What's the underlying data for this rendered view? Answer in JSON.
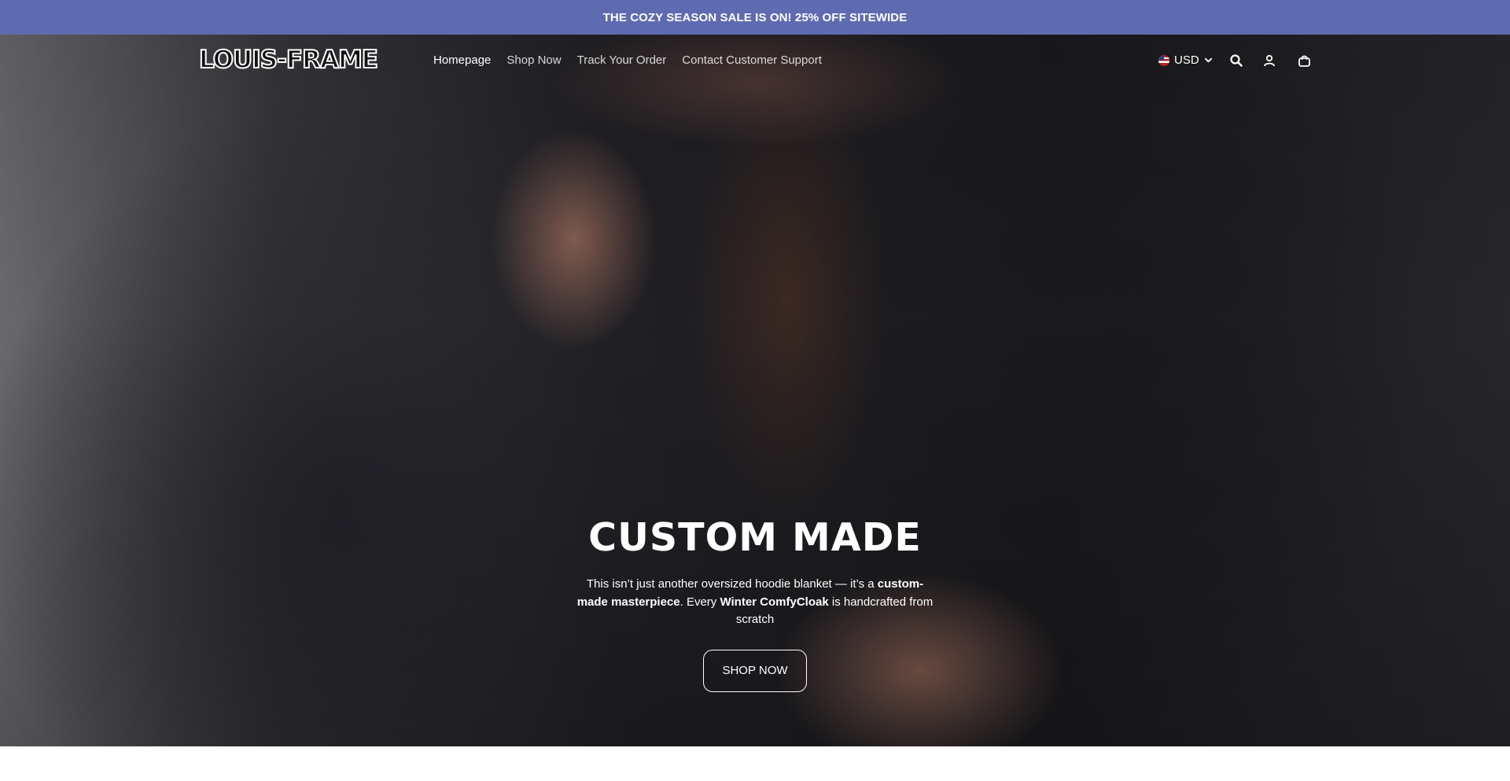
{
  "announcement": {
    "text": "THE COZY SEASON SALE IS ON! 25% OFF SITEWIDE"
  },
  "header": {
    "logo_text": "LOUIS-FRAME",
    "nav": [
      {
        "label": "Homepage"
      },
      {
        "label": "Shop Now"
      },
      {
        "label": "Track Your Order"
      },
      {
        "label": "Contact Customer Support"
      }
    ],
    "currency": {
      "selected": "USD",
      "flag_icon": "us-flag-icon"
    },
    "icons": [
      "search-icon",
      "account-icon",
      "cart-icon"
    ]
  },
  "hero": {
    "title": "CUSTOM MADE",
    "text_parts": [
      "This isn’t just another oversized hoodie blanket — it’s a ",
      "custom-made masterpiece",
      ". Every ",
      "Winter ComfyCloak",
      " is handcrafted from scratch"
    ],
    "button_label": "SHOP NOW"
  },
  "colors": {
    "announcement_bg": "#5f6bb0",
    "text": "#ffffff"
  }
}
